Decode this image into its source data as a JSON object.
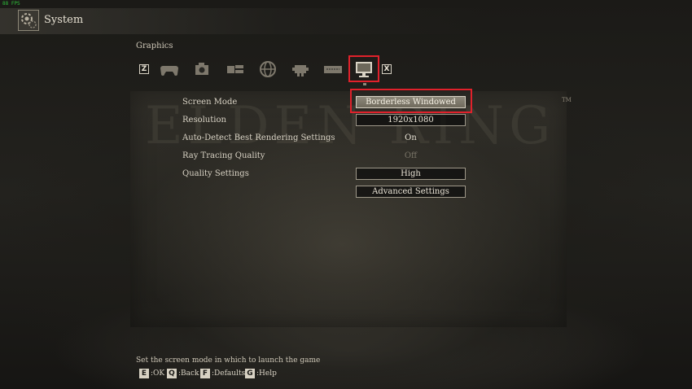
{
  "fps": "88 FPS",
  "header": {
    "title": "System",
    "icon": "gear-icon"
  },
  "section": "Graphics",
  "tabs": {
    "prev_key": "Z",
    "next_key": "X",
    "items": [
      {
        "icon": "gamepad-icon"
      },
      {
        "icon": "camera-icon"
      },
      {
        "icon": "display-settings-icon"
      },
      {
        "icon": "globe-icon"
      },
      {
        "icon": "network-icon"
      },
      {
        "icon": "keyboard-icon"
      },
      {
        "icon": "monitor-icon",
        "active": true
      }
    ]
  },
  "settings": [
    {
      "label": "Screen Mode",
      "value": "Borderless Windowed",
      "selected": true
    },
    {
      "label": "Resolution",
      "value": "1920x1080"
    },
    {
      "label": "Auto-Detect Best Rendering Settings",
      "value": "On"
    },
    {
      "label": "Ray Tracing Quality",
      "value": "Off",
      "disabled": true
    },
    {
      "label": "Quality Settings",
      "value": "High"
    }
  ],
  "advanced_button": "Advanced Settings",
  "watermark": "ELDEN RING",
  "trademark": "TM",
  "help_text": "Set the screen mode in which to launch the game",
  "hints": [
    {
      "key": "E",
      "label": ":OK"
    },
    {
      "key": "Q",
      "label": ":Back"
    },
    {
      "key": "F",
      "label": ":Defaults"
    },
    {
      "key": "G",
      "label": ":Help"
    }
  ],
  "colors": {
    "highlight": "#e0212b",
    "text": "#d8d2c4"
  }
}
